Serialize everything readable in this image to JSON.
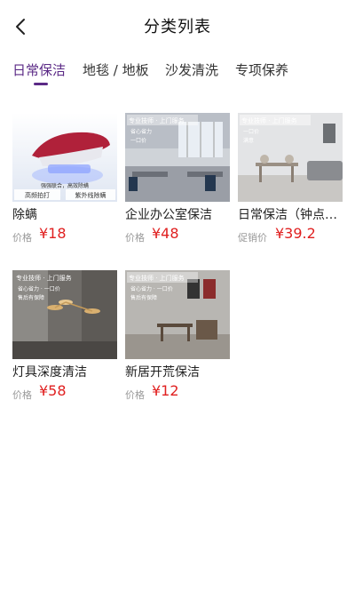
{
  "header": {
    "title": "分类列表",
    "back_icon": "chevron-left-icon"
  },
  "tabs": [
    {
      "label": "日常保洁",
      "active": true
    },
    {
      "label": "地毯 / 地板",
      "active": false
    },
    {
      "label": "沙发清洗",
      "active": false
    },
    {
      "label": "专项保养",
      "active": false
    }
  ],
  "colors": {
    "accent": "#5b2a86",
    "price": "#e02020",
    "muted": "#999999"
  },
  "items": [
    {
      "name": "除螨",
      "price_label": "价格",
      "price": "¥18",
      "image_text": {
        "badge_left": "高频拍打",
        "badge_right": "紫外线除螨",
        "caption": "强强联合，高效除螨"
      }
    },
    {
      "name": "企业办公室保洁",
      "price_label": "价格",
      "price": "¥48",
      "image_text": {
        "banner": "专业技师 · 上门服务",
        "line1": "省心省力",
        "line2": "一口价"
      }
    },
    {
      "name": "日常保洁（钟点工）",
      "price_label": "促销价",
      "price": "¥39.2",
      "image_text": {
        "banner": "专业技师 · 上门服务",
        "line1": "一口价",
        "line2": "满意"
      }
    },
    {
      "name": "灯具深度清洁",
      "price_label": "价格",
      "price": "¥58",
      "image_text": {
        "banner": "专业技师 · 上门服务",
        "line1": "省心省力 · 一口价",
        "line2": "售后有保障"
      }
    },
    {
      "name": "新居开荒保洁",
      "price_label": "价格",
      "price": "¥12",
      "image_text": {
        "banner": "专业技师 · 上门服务",
        "line1": "省心省力 · 一口价",
        "line2": "售后有保障"
      }
    }
  ]
}
